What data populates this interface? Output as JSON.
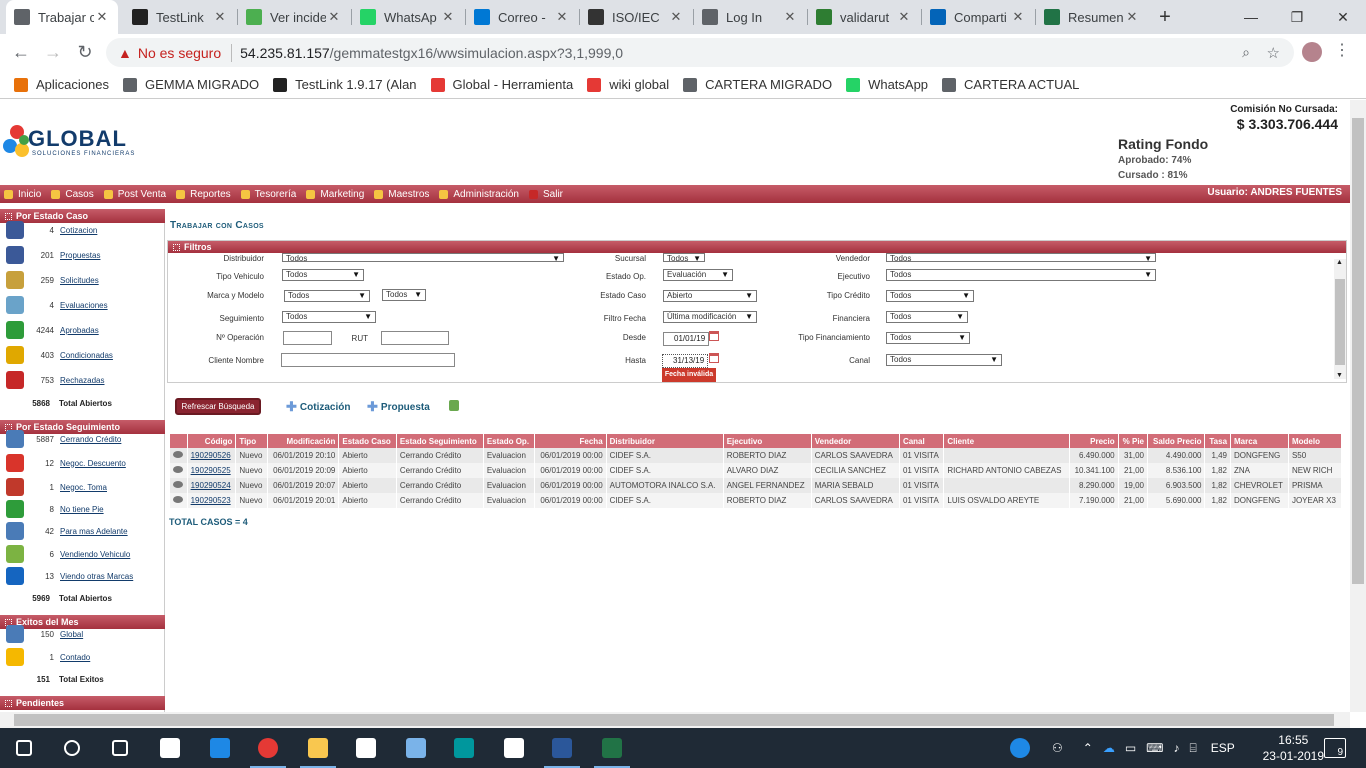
{
  "browser": {
    "tabs": [
      {
        "label": "Trabajar c",
        "icon": "document-icon",
        "color": "#5f6368",
        "active": true
      },
      {
        "label": "TestLink",
        "icon": "testlink-icon",
        "color": "#222"
      },
      {
        "label": "Ver incide",
        "icon": "bug-icon",
        "color": "#4caf50"
      },
      {
        "label": "WhatsAp",
        "icon": "whatsapp-icon",
        "color": "#25d366"
      },
      {
        "label": "Correo -",
        "icon": "outlook-icon",
        "color": "#0078d4"
      },
      {
        "label": "ISO/IEC",
        "icon": "wikipedia-icon",
        "color": "#333"
      },
      {
        "label": "Log In",
        "icon": "document-icon",
        "color": "#5f6368"
      },
      {
        "label": "validarut",
        "icon": "check-icon",
        "color": "#2e7d32"
      },
      {
        "label": "Comparti",
        "icon": "cloud-icon",
        "color": "#0364b8"
      },
      {
        "label": "Resumen",
        "icon": "excel-icon",
        "color": "#217346"
      }
    ],
    "new_tab": "+",
    "window_buttons": {
      "minimize": "—",
      "maximize": "❐",
      "close": "✕"
    },
    "address": {
      "security_label": "No es seguro",
      "url_host": "54.235.81.157",
      "url_path": "/gemmatestgx16/wwsimulacion.aspx?3,1,999,0"
    },
    "bookmarks": [
      {
        "label": "Aplicaciones",
        "icon": "apps-grid-icon",
        "color": "#e8710a"
      },
      {
        "label": "GEMMA MIGRADO",
        "icon": "document-icon",
        "color": "#5f6368"
      },
      {
        "label": "TestLink 1.9.17 (Alan",
        "icon": "testlink-icon",
        "color": "#222"
      },
      {
        "label": "Global - Herramienta",
        "icon": "global-logo-icon",
        "color": "#e53935"
      },
      {
        "label": "wiki global",
        "icon": "global-logo-icon",
        "color": "#e53935"
      },
      {
        "label": "CARTERA MIGRADO",
        "icon": "document-icon",
        "color": "#5f6368"
      },
      {
        "label": "WhatsApp",
        "icon": "whatsapp-icon",
        "color": "#25d366"
      },
      {
        "label": "CARTERA ACTUAL",
        "icon": "document-icon",
        "color": "#5f6368"
      }
    ]
  },
  "app": {
    "logo_text": "GLOBAL",
    "logo_sub": "SOLUCIONES FINANCIERAS",
    "comision_label": "Comisión No Cursada:",
    "comision_value": "$ 3.303.706.444",
    "rating_title": "Rating Fondo",
    "rating_aprobado": "Aprobado: 74%",
    "rating_cursado": "Cursado : 81%",
    "menu": [
      "Inicio",
      "Casos",
      "Post Venta",
      "Reportes",
      "Tesorería",
      "Marketing",
      "Maestros",
      "Administración",
      "Salir"
    ],
    "user_label": "Usuario:  ANDRES FUENTES"
  },
  "sidebar": {
    "sections": [
      {
        "title": "Por Estado Caso",
        "items": [
          {
            "count": "4",
            "label": "Cotizacion",
            "color": "#3b5998"
          },
          {
            "count": "201",
            "label": "Propuestas",
            "color": "#3b5998"
          },
          {
            "count": "259",
            "label": "Solicitudes",
            "color": "#c7a03c"
          },
          {
            "count": "4",
            "label": "Evaluaciones",
            "color": "#6aa3c9"
          },
          {
            "count": "4244",
            "label": "Aprobadas",
            "color": "#2e9c3a"
          },
          {
            "count": "403",
            "label": "Condicionadas",
            "color": "#e0a800"
          },
          {
            "count": "753",
            "label": "Rechazadas",
            "color": "#c62828"
          }
        ],
        "total_count": "5868",
        "total_label": "Total Abiertos"
      },
      {
        "title": "Por Estado Seguimiento",
        "items": [
          {
            "count": "5887",
            "label": "Cerrando Crédito",
            "color": "#4a7bb7"
          },
          {
            "count": "12",
            "label": "Negoc. Descuento",
            "color": "#d9342b"
          },
          {
            "count": "1",
            "label": "Negoc. Toma",
            "color": "#c0392b"
          },
          {
            "count": "8",
            "label": "No tiene Pie",
            "color": "#2e9c3a"
          },
          {
            "count": "42",
            "label": "Para mas Adelante",
            "color": "#4a7bb7"
          },
          {
            "count": "6",
            "label": "Vendiendo Vehiculo",
            "color": "#7cb342"
          },
          {
            "count": "13",
            "label": "Viendo otras Marcas",
            "color": "#1565c0"
          }
        ],
        "total_count": "5969",
        "total_label": "Total Abiertos"
      },
      {
        "title": "Exitos del Mes",
        "items": [
          {
            "count": "150",
            "label": "Global",
            "color": "#4a7bb7"
          },
          {
            "count": "1",
            "label": "Contado",
            "color": "#f5b800"
          }
        ],
        "total_count": "151",
        "total_label": "Total Exitos"
      },
      {
        "title": "Pendientes",
        "items": []
      }
    ]
  },
  "main": {
    "title": "Trabajar con Casos",
    "filters_title": "Filtros",
    "filters": {
      "distribuidor": {
        "label": "Distribuidor",
        "value": "Todos"
      },
      "sucursal": {
        "label": "Sucursal",
        "value": "Todos"
      },
      "vendedor": {
        "label": "Vendedor",
        "value": "Todos"
      },
      "tipo_vehiculo": {
        "label": "Tipo Vehiculo",
        "value": "Todos"
      },
      "estado_op": {
        "label": "Estado Op.",
        "value": "Evaluación"
      },
      "ejecutivo": {
        "label": "Ejecutivo",
        "value": "Todos"
      },
      "marca_modelo": {
        "label": "Marca y Modelo",
        "value": "Todos",
        "value2": "Todos"
      },
      "estado_caso": {
        "label": "Estado Caso",
        "value": "Abierto"
      },
      "tipo_credito": {
        "label": "Tipo Crédito",
        "value": "Todos"
      },
      "seguimiento": {
        "label": "Seguimiento",
        "value": "Todos"
      },
      "filtro_fecha": {
        "label": "Filtro Fecha",
        "value": "Última modificación"
      },
      "financiera": {
        "label": "Financiera",
        "value": "Todos"
      },
      "n_operacion": {
        "label": "Nº Operación",
        "value": ""
      },
      "rut": {
        "label": "RUT",
        "value": ""
      },
      "desde": {
        "label": "Desde",
        "value": "01/01/19"
      },
      "tipo_financiamiento": {
        "label": "Tipo Financiamiento",
        "value": "Todos"
      },
      "cliente_nombre": {
        "label": "Cliente Nombre",
        "value": ""
      },
      "hasta": {
        "label": "Hasta",
        "value": "31/13/19"
      },
      "canal": {
        "label": "Canal",
        "value": "Todos"
      },
      "fecha_invalida": "Fecha inválida"
    },
    "buttons": {
      "refresh": "Refrescar Búsqueda",
      "cotizacion": "Cotización",
      "propuesta": "Propuesta"
    },
    "table": {
      "columns": [
        "",
        "Código",
        "Tipo",
        "Modificación",
        "Estado Caso",
        "Estado Seguimiento",
        "Estado Op.",
        "Fecha",
        "Distribuidor",
        "Ejecutivo",
        "Vendedor",
        "Canal",
        "Cliente",
        "Precio",
        "% Pie",
        "Saldo Precio",
        "Tasa",
        "Marca",
        "Modelo"
      ],
      "rows": [
        [
          "190290526",
          "Nuevo",
          "06/01/2019 20:10",
          "Abierto",
          "Cerrando Crédito",
          "Evaluacion",
          "06/01/2019 00:00",
          "CIDEF S.A.",
          "ROBERTO DIAZ",
          "CARLOS SAAVEDRA",
          "01 VISITA",
          "",
          "6.490.000",
          "31,00",
          "4.490.000",
          "1,49",
          "DONGFENG",
          "S50"
        ],
        [
          "190290525",
          "Nuevo",
          "06/01/2019 20:09",
          "Abierto",
          "Cerrando Crédito",
          "Evaluacion",
          "06/01/2019 00:00",
          "CIDEF S.A.",
          "ALVARO DIAZ",
          "CECILIA SANCHEZ",
          "01 VISITA",
          "RICHARD ANTONIO CABEZAS",
          "10.341.100",
          "21,00",
          "8.536.100",
          "1,82",
          "ZNA",
          "NEW RICH"
        ],
        [
          "190290524",
          "Nuevo",
          "06/01/2019 20:07",
          "Abierto",
          "Cerrando Crédito",
          "Evaluacion",
          "06/01/2019 00:00",
          "AUTOMOTORA INALCO S.A.",
          "ANGEL FERNANDEZ",
          "MARIA SEBALD",
          "01 VISITA",
          "",
          "8.290.000",
          "19,00",
          "6.903.500",
          "1,82",
          "CHEVROLET",
          "PRISMA"
        ],
        [
          "190290523",
          "Nuevo",
          "06/01/2019 20:01",
          "Abierto",
          "Cerrando Crédito",
          "Evaluacion",
          "06/01/2019 00:00",
          "CIDEF S.A.",
          "ROBERTO DIAZ",
          "CARLOS SAAVEDRA",
          "01 VISITA",
          "LUIS OSVALDO AREYTE",
          "7.190.000",
          "21,00",
          "5.690.000",
          "1,82",
          "DONGFENG",
          "JOYEAR X3"
        ]
      ],
      "total_label": "TOTAL CASOS =  4"
    }
  },
  "taskbar": {
    "apps": [
      {
        "name": "start-icon",
        "color": "#ffffff"
      },
      {
        "name": "search-icon",
        "color": "#ffffff"
      },
      {
        "name": "task-view-icon",
        "color": "#ffffff"
      },
      {
        "name": "dropbox-icon",
        "color": "#ffffff"
      },
      {
        "name": "edge-icon",
        "color": "#1e88e5"
      },
      {
        "name": "chrome-icon",
        "color": "#e53935"
      },
      {
        "name": "file-explorer-icon",
        "color": "#f9c74f"
      },
      {
        "name": "store-icon",
        "color": "#ffffff"
      },
      {
        "name": "notepad-icon",
        "color": "#7ab3e9"
      },
      {
        "name": "arduino-icon",
        "color": "#00979d"
      },
      {
        "name": "mail-icon",
        "color": "#ffffff"
      },
      {
        "name": "word-icon",
        "color": "#2b579a"
      },
      {
        "name": "excel-icon",
        "color": "#217346"
      }
    ],
    "language": "ESP",
    "time": "16:55",
    "date": "23-01-2019",
    "notifications": "9"
  }
}
